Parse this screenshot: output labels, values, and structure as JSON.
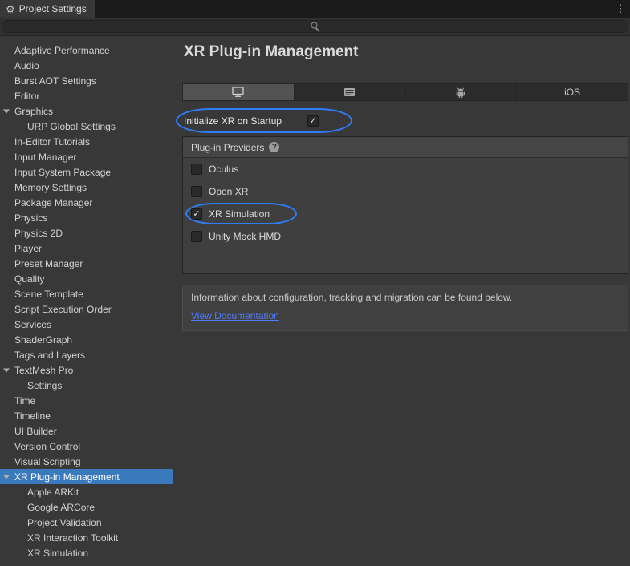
{
  "window": {
    "title_tab": "Project Settings"
  },
  "icons": {
    "gear": "⚙",
    "kebab": "⋮",
    "checkmark": "✓",
    "help": "?"
  },
  "colors": {
    "selection": "#3A79BB",
    "annotation": "#2E7CF6",
    "link": "#4C7EFF"
  },
  "search": {
    "value": "",
    "placeholder": ""
  },
  "sidebar": {
    "items": [
      {
        "label": "Adaptive Performance",
        "indent": 0,
        "foldout": false,
        "selected": false
      },
      {
        "label": "Audio",
        "indent": 0,
        "foldout": false,
        "selected": false
      },
      {
        "label": "Burst AOT Settings",
        "indent": 0,
        "foldout": false,
        "selected": false
      },
      {
        "label": "Editor",
        "indent": 0,
        "foldout": false,
        "selected": false
      },
      {
        "label": "Graphics",
        "indent": 0,
        "foldout": true,
        "selected": false
      },
      {
        "label": "URP Global Settings",
        "indent": 1,
        "foldout": false,
        "selected": false
      },
      {
        "label": "In-Editor Tutorials",
        "indent": 0,
        "foldout": false,
        "selected": false
      },
      {
        "label": "Input Manager",
        "indent": 0,
        "foldout": false,
        "selected": false
      },
      {
        "label": "Input System Package",
        "indent": 0,
        "foldout": false,
        "selected": false
      },
      {
        "label": "Memory Settings",
        "indent": 0,
        "foldout": false,
        "selected": false
      },
      {
        "label": "Package Manager",
        "indent": 0,
        "foldout": false,
        "selected": false
      },
      {
        "label": "Physics",
        "indent": 0,
        "foldout": false,
        "selected": false
      },
      {
        "label": "Physics 2D",
        "indent": 0,
        "foldout": false,
        "selected": false
      },
      {
        "label": "Player",
        "indent": 0,
        "foldout": false,
        "selected": false
      },
      {
        "label": "Preset Manager",
        "indent": 0,
        "foldout": false,
        "selected": false
      },
      {
        "label": "Quality",
        "indent": 0,
        "foldout": false,
        "selected": false
      },
      {
        "label": "Scene Template",
        "indent": 0,
        "foldout": false,
        "selected": false
      },
      {
        "label": "Script Execution Order",
        "indent": 0,
        "foldout": false,
        "selected": false
      },
      {
        "label": "Services",
        "indent": 0,
        "foldout": false,
        "selected": false
      },
      {
        "label": "ShaderGraph",
        "indent": 0,
        "foldout": false,
        "selected": false
      },
      {
        "label": "Tags and Layers",
        "indent": 0,
        "foldout": false,
        "selected": false
      },
      {
        "label": "TextMesh Pro",
        "indent": 0,
        "foldout": true,
        "selected": false
      },
      {
        "label": "Settings",
        "indent": 1,
        "foldout": false,
        "selected": false
      },
      {
        "label": "Time",
        "indent": 0,
        "foldout": false,
        "selected": false
      },
      {
        "label": "Timeline",
        "indent": 0,
        "foldout": false,
        "selected": false
      },
      {
        "label": "UI Builder",
        "indent": 0,
        "foldout": false,
        "selected": false
      },
      {
        "label": "Version Control",
        "indent": 0,
        "foldout": false,
        "selected": false
      },
      {
        "label": "Visual Scripting",
        "indent": 0,
        "foldout": false,
        "selected": false
      },
      {
        "label": "XR Plug-in Management",
        "indent": 0,
        "foldout": true,
        "selected": true
      },
      {
        "label": "Apple ARKit",
        "indent": 1,
        "foldout": false,
        "selected": false
      },
      {
        "label": "Google ARCore",
        "indent": 1,
        "foldout": false,
        "selected": false
      },
      {
        "label": "Project Validation",
        "indent": 1,
        "foldout": false,
        "selected": false
      },
      {
        "label": "XR Interaction Toolkit",
        "indent": 1,
        "foldout": false,
        "selected": false
      },
      {
        "label": "XR Simulation",
        "indent": 1,
        "foldout": false,
        "selected": false
      }
    ]
  },
  "main": {
    "title": "XR Plug-in Management",
    "platform_tabs": [
      {
        "name": "desktop",
        "icon": "desktop-monitor-icon",
        "label": "",
        "selected": true
      },
      {
        "name": "universal",
        "icon": "server-list-icon",
        "label": "",
        "selected": false
      },
      {
        "name": "android",
        "icon": "android-robot-icon",
        "label": "",
        "selected": false
      },
      {
        "name": "ios",
        "icon": "",
        "label": "iOS",
        "selected": false
      }
    ],
    "initialize_row": {
      "label": "Initialize XR on Startup",
      "checked": true,
      "annotated": true
    },
    "providers": {
      "header": "Plug-in Providers",
      "items": [
        {
          "label": "Oculus",
          "checked": false,
          "annotated": false
        },
        {
          "label": "Open XR",
          "checked": false,
          "annotated": false
        },
        {
          "label": "XR Simulation",
          "checked": true,
          "annotated": true
        },
        {
          "label": "Unity Mock HMD",
          "checked": false,
          "annotated": false
        }
      ]
    },
    "info": {
      "text": "Information about configuration, tracking and migration can be found below.",
      "link": "View Documentation"
    }
  }
}
